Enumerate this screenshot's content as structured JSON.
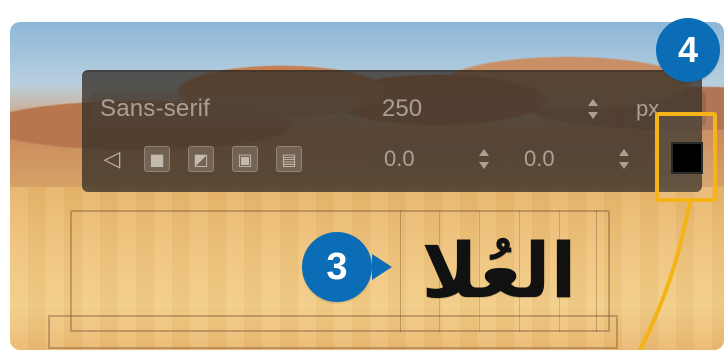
{
  "toolbar": {
    "font_family": "Sans-serif",
    "font_size": "250",
    "unit": "px",
    "offset_x": "0.0",
    "offset_y": "0.0"
  },
  "badges": {
    "step_3": "3",
    "step_4": "4"
  },
  "canvas": {
    "text": "العُلا"
  },
  "colors": {
    "badge_blue": "#0b6db6",
    "highlight_yellow": "#f4b316",
    "swatch_color": "#000000"
  },
  "icons": {
    "toolbar_icons": [
      "back-icon",
      "bold-icon",
      "italic-icon",
      "underline-icon",
      "strike-icon"
    ]
  }
}
